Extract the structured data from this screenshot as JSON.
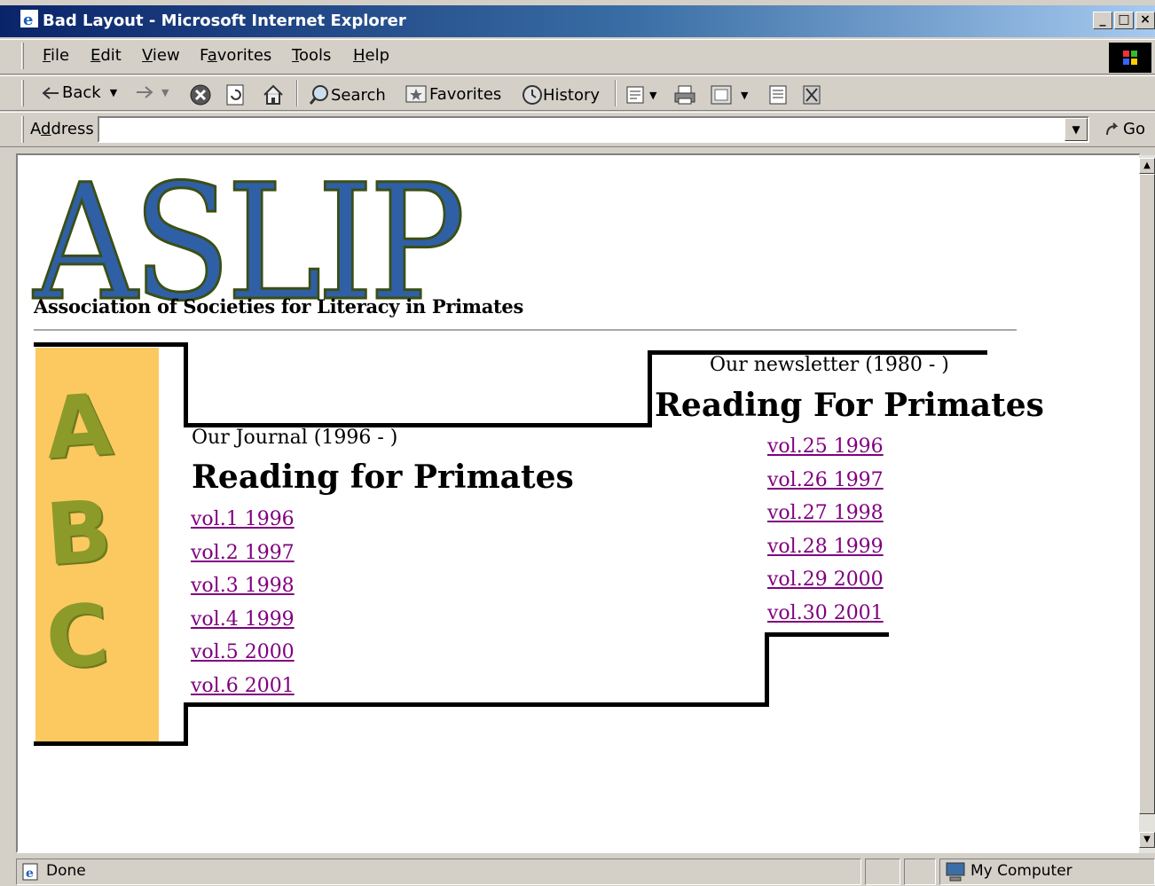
{
  "window": {
    "title": "Bad Layout - Microsoft Internet Explorer",
    "controls": {
      "minimize": "_",
      "maximize": "□",
      "close": "×"
    }
  },
  "menu": {
    "items": [
      {
        "pre": "",
        "key": "F",
        "post": "ile"
      },
      {
        "pre": "",
        "key": "E",
        "post": "dit"
      },
      {
        "pre": "",
        "key": "V",
        "post": "iew"
      },
      {
        "pre": "F",
        "key": "a",
        "post": "vorites"
      },
      {
        "pre": "",
        "key": "T",
        "post": "ools"
      },
      {
        "pre": "",
        "key": "H",
        "post": "elp"
      }
    ]
  },
  "toolbar": {
    "back": "Back",
    "search": "Search",
    "favorites": "Favorites",
    "history": "History"
  },
  "address": {
    "label_pre": "A",
    "label_key": "d",
    "label_post": "dress",
    "value": "",
    "go": "Go"
  },
  "page": {
    "logo": "ASLIP",
    "tagline": "Association of Societies for Literacy in Primates",
    "abc": [
      "A",
      "B",
      "C"
    ],
    "journal": {
      "subtitle": "Our Journal (1996 - )",
      "title": "Reading for Primates",
      "volumes": [
        "vol.1 1996",
        "vol.2 1997",
        "vol.3 1998",
        "vol.4 1999",
        "vol.5 2000",
        "vol.6 2001"
      ]
    },
    "newsletter": {
      "subtitle": "Our newsletter (1980 - )",
      "title": "Reading For Primates",
      "volumes": [
        "vol.25 1996",
        "vol.26 1997",
        "vol.27 1998",
        "vol.28 1999",
        "vol.29 2000",
        "vol.30 2001"
      ]
    },
    "colors": {
      "link_visited": "#800080",
      "logo_fill": "#2f5fa5",
      "logo_stroke": "#3b4f14",
      "strip": "#fcc960"
    }
  },
  "status": {
    "text": "Done",
    "zone": "My Computer"
  },
  "icons": [
    "ie-icon",
    "windows-logo-icon",
    "back-arrow-icon",
    "forward-arrow-icon",
    "stop-icon",
    "refresh-icon",
    "home-icon",
    "search-icon",
    "favorites-icon",
    "history-icon",
    "mail-icon",
    "print-icon",
    "edit-icon",
    "discuss-icon",
    "messenger-icon",
    "go-arrow-icon",
    "page-icon",
    "computer-icon"
  ]
}
